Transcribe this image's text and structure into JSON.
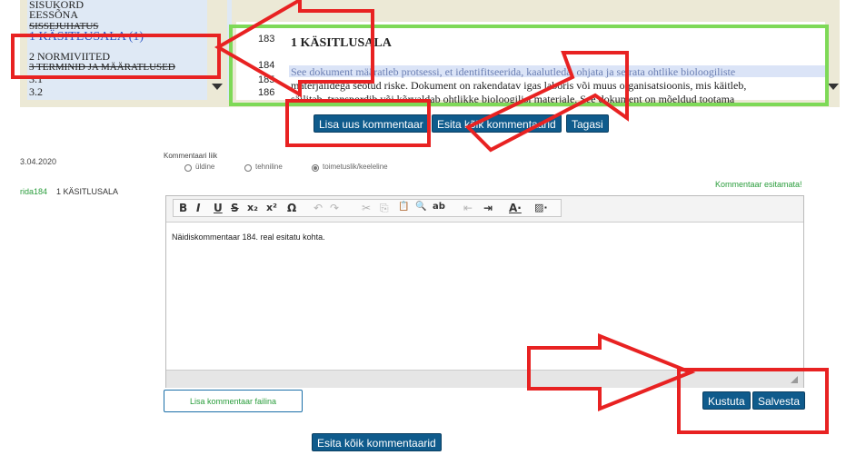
{
  "toc": {
    "items": [
      {
        "label": "SISUKORD"
      },
      {
        "label": "EESSÕNA"
      },
      {
        "label": "SISSEJUHATUS"
      },
      {
        "label": "1 KÄSITLUSALA (1)"
      },
      {
        "label": "2 NORMIVIITED"
      },
      {
        "label": "3 TERMINID JA MÄÄRATLUSED"
      },
      {
        "label": "3.1"
      },
      {
        "label": "3.2"
      }
    ]
  },
  "document": {
    "line_numbers": [
      "183",
      "184",
      "185",
      "186"
    ],
    "heading": "1   KÄSITLUSALA",
    "lines": [
      "See dokument määratleb protsessi, et identifitseerida, kaalutleda, ohjata ja seirata ohtlike bioloogiliste",
      "materjalidega seotud riske. Dokument on rakendatav igas laboris või muus organisatsioonis, mis käitleb,",
      "säilitab, transpordib või kõrvaldab ohtlikke bioloogilisi materjale. See dokument on mõeldud tootama"
    ]
  },
  "actions": {
    "add_comment": "Lisa uus kommentaar",
    "submit_all": "Esita kõik kommentaarid",
    "back": "Tagasi"
  },
  "comment": {
    "date": "3.04.2020",
    "row_ref": "rida184",
    "section": "1 KÄSITLUSALA",
    "type_label": "Kommentaari liik",
    "types": [
      "üldine",
      "tehniline",
      "toimetuslik/keeleline"
    ],
    "selected_type": "toimetuslik/keeleline",
    "status": "Kommentaar esitamata!",
    "text": "Näidiskommentaar 184. real esitatu kohta.",
    "add_file": "Lisa kommentaar failina",
    "delete": "Kustuta",
    "save": "Salvesta",
    "submit_all_bottom": "Esita kõik kommentaarid"
  },
  "toolbar": {
    "bold": "B",
    "italic": "I",
    "underline": "U",
    "strike": "S",
    "subscript": "x₂",
    "superscript": "x²",
    "special_char": "Ω",
    "undo": "↶",
    "redo": "↷",
    "cut": "✂",
    "copy": "⎘",
    "paste": "📋",
    "find": "🔍",
    "replace": "ab",
    "indent_less": "⇤",
    "indent_more": "⇥",
    "text_color": "A·",
    "bg_color": "▨·"
  },
  "colors": {
    "button_bg": "#0f5b8c",
    "annotation_red": "#e82222",
    "annotation_green": "#7ed957",
    "status_green": "#2a9d3c",
    "row_ref_green": "#2a9d3c"
  }
}
